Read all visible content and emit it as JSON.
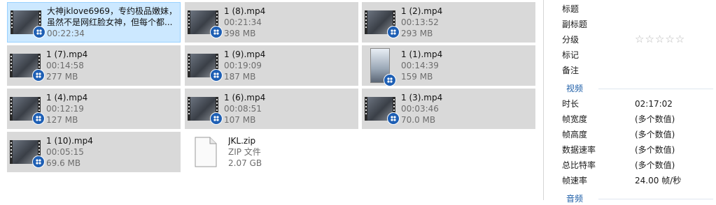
{
  "files": [
    {
      "name_line1": "大神jklove6969，专约极品嫩妹，",
      "name_line2": "虽然不是网红脸女神，但每个都...",
      "meta1": "00:22:34",
      "icon": "video-thumbnail-icon",
      "selected": true
    },
    {
      "name_line1": "1 (8).mp4",
      "meta1": "00:21:34",
      "meta2": "398 MB",
      "icon": "video-thumbnail-icon"
    },
    {
      "name_line1": "1 (2).mp4",
      "meta1": "00:13:52",
      "meta2": "293 MB",
      "icon": "video-thumbnail-icon"
    },
    {
      "name_line1": "1 (7).mp4",
      "meta1": "00:14:58",
      "meta2": "277 MB",
      "icon": "video-thumbnail-icon"
    },
    {
      "name_line1": "1 (9).mp4",
      "meta1": "00:19:09",
      "meta2": "187 MB",
      "icon": "video-thumbnail-icon"
    },
    {
      "name_line1": "1 (1).mp4",
      "meta1": "00:14:39",
      "meta2": "159 MB",
      "icon": "video-thumbnail-icon"
    },
    {
      "name_line1": "1 (4).mp4",
      "meta1": "00:12:19",
      "meta2": "127 MB",
      "icon": "video-thumbnail-icon"
    },
    {
      "name_line1": "1 (6).mp4",
      "meta1": "00:08:51",
      "meta2": "107 MB",
      "icon": "video-thumbnail-icon"
    },
    {
      "name_line1": "1 (3).mp4",
      "meta1": "00:03:46",
      "meta2": "70.0 MB",
      "icon": "video-thumbnail-icon"
    },
    {
      "name_line1": "1 (10).mp4",
      "meta1": "00:05:15",
      "meta2": "69.6 MB",
      "icon": "video-thumbnail-icon"
    },
    {
      "name_line1": "JKL.zip",
      "meta1": "ZIP 文件",
      "meta2": "2.07 GB",
      "icon": "zip-file-icon"
    }
  ],
  "details": {
    "title_label": "标题",
    "subtitle_label": "副标题",
    "rating_label": "分级",
    "rating_stars": "☆☆☆☆☆",
    "tags_label": "标记",
    "comments_label": "备注",
    "video_section": "视频",
    "video": [
      {
        "label": "时长",
        "value": "02:17:02"
      },
      {
        "label": "帧宽度",
        "value": "(多个数值)"
      },
      {
        "label": "帧高度",
        "value": "(多个数值)"
      },
      {
        "label": "数据速率",
        "value": "(多个数值)"
      },
      {
        "label": "总比特率",
        "value": "(多个数值)"
      },
      {
        "label": "帧速率",
        "value": "24.00 帧/秒"
      }
    ],
    "audio_section": "音频"
  },
  "colors": {
    "tile": "#d9d9d9",
    "selected": "#cce8ff",
    "accent": "#1f5fa8"
  }
}
